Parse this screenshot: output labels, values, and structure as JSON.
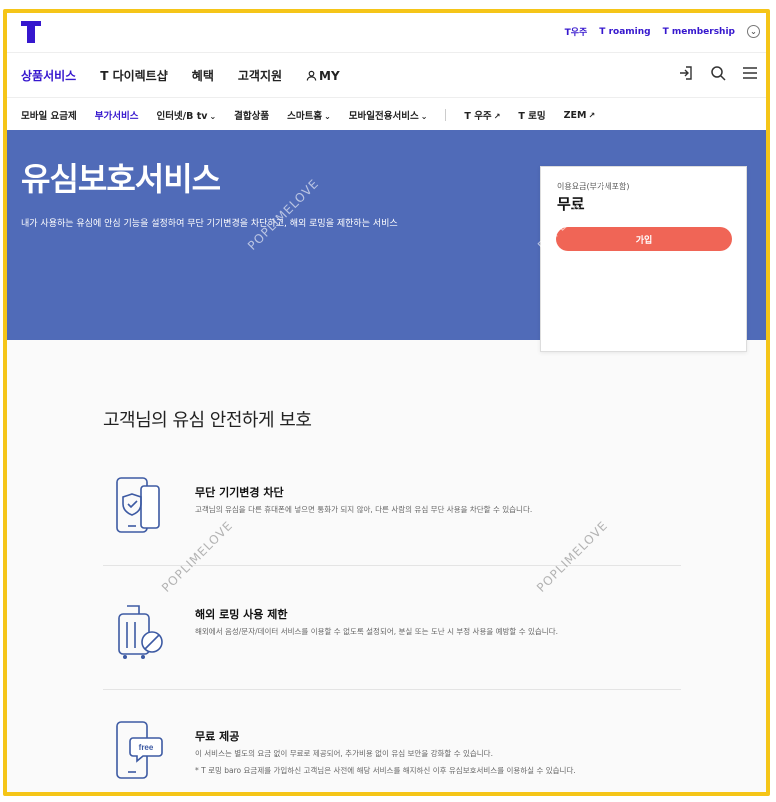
{
  "util": {
    "links": [
      "T우주",
      "T roaming",
      "T membership"
    ]
  },
  "gnb": {
    "items": [
      "상품서비스",
      "T 다이렉트샵",
      "혜택",
      "고객지원",
      "MY"
    ]
  },
  "subnav": {
    "items": [
      "모바일 요금제",
      "부가서비스",
      "인터넷/B tv",
      "결합상품",
      "스마트홈",
      "모바일전용서비스"
    ],
    "links": [
      "T 우주",
      "T 로밍",
      "ZEM"
    ]
  },
  "hero": {
    "title": "유심보호서비스",
    "description": "내가 사용하는 유심에 안심 기능을 설정하여 무단 기기변경을 차단하고, 해외 로밍을 제한하는 서비스"
  },
  "price": {
    "label": "이용요금(부가세포함)",
    "value": "무료",
    "join_label": "가입"
  },
  "section": {
    "title": "고객님의 유심 안전하게 보호"
  },
  "features": [
    {
      "title": "무단 기기변경 차단",
      "description": "고객님의 유심을 다른 휴대폰에 넣으면 통화가 되지 않아, 다른 사람의 유심 무단 사용을 차단할 수 있습니다."
    },
    {
      "title": "해외 로밍 사용 제한",
      "description": "해외에서 음성/문자/데이터 서비스를 이용할 수 없도록 설정되어, 분실 또는 도난 시 부정 사용을 예방할 수 있습니다."
    },
    {
      "title": "무료 제공",
      "description": "이 서비스는 별도의 요금 없이 무료로 제공되어, 추가비용 없이 유심 보안을 강화할 수 있습니다.",
      "note": "* T 로밍 baro 요금제를 가입하신 고객님은 사전에 해당 서비스를 해지하신 이후 유심보호서비스를 이용하실 수 있습니다."
    }
  ],
  "free_badge": "free",
  "watermark": "POPLIMELOVE",
  "colors": {
    "brand": "#3617ce",
    "hero_bg": "#506bb8",
    "join_button": "#f06556",
    "frame": "#f5c518"
  }
}
